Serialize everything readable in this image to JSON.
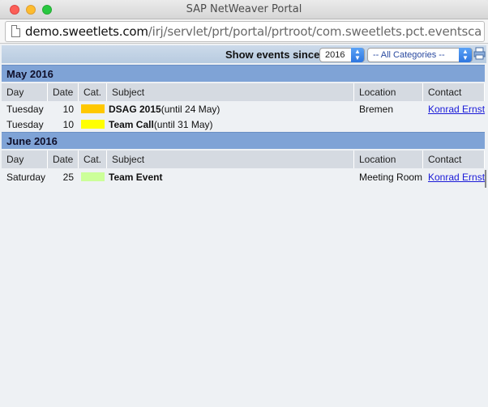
{
  "window": {
    "title": "SAP NetWeaver Portal"
  },
  "address_bar": {
    "domain": "demo.sweetlets.com",
    "path": "/irj/servlet/prt/portal/prtroot/com.sweetlets.pct.eventscalendar.O..."
  },
  "toolbar": {
    "show_label": "Show events since",
    "year_value": "2016",
    "category_value": "-- All Categories --",
    "icons": {
      "print": "print-icon"
    }
  },
  "columns": [
    "Day",
    "Date",
    "Cat.",
    "Subject",
    "Location",
    "Contact"
  ],
  "months": [
    {
      "title": "May 2016",
      "events": [
        {
          "day": "Tuesday",
          "date": "10",
          "cat_color": "#ffc800",
          "subject": "DSAG 2015",
          "until": "(until 24 May)",
          "location": "Bremen",
          "contact": "Konrad Ernst"
        },
        {
          "day": "Tuesday",
          "date": "10",
          "cat_color": "#ffff00",
          "subject": "Team Call",
          "until": "(until 31 May)",
          "location": "",
          "contact": ""
        }
      ]
    },
    {
      "title": "June 2016",
      "events": [
        {
          "day": "Saturday",
          "date": "25",
          "cat_color": "#ccff99",
          "subject": "Team Event",
          "until": "",
          "location": "Meeting Room",
          "contact": "Konrad Ernst"
        }
      ]
    }
  ]
}
